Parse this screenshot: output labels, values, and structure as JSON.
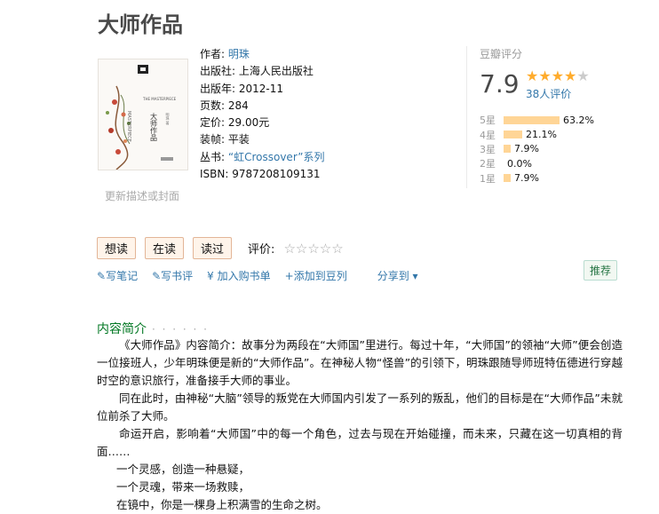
{
  "title": "大师作品",
  "cover": {
    "update_link": "更新描述或封面",
    "vertical_title": "大师作品",
    "latin": "MASTERPIECE"
  },
  "info": {
    "author_label": "作者:",
    "author": "明珠",
    "publisher_label": "出版社:",
    "publisher": "上海人民出版社",
    "year_label": "出版年:",
    "year": "2012-11",
    "pages_label": "页数:",
    "pages": "284",
    "price_label": "定价:",
    "price": "29.00元",
    "binding_label": "装帧:",
    "binding": "平装",
    "series_label": "丛书:",
    "series": "“虹Crossover”系列",
    "isbn_label": "ISBN:",
    "isbn": "9787208109131"
  },
  "rating": {
    "label": "豆瓣评分",
    "score": "7.9",
    "stars_on": "★★★★",
    "stars_off": "★",
    "count": "38人评价",
    "bars": [
      {
        "label": "5星",
        "pct": "63.2%",
        "fraction": 0.632
      },
      {
        "label": "4星",
        "pct": "21.1%",
        "fraction": 0.211
      },
      {
        "label": "3星",
        "pct": "7.9%",
        "fraction": 0.079
      },
      {
        "label": "2星",
        "pct": "0.0%",
        "fraction": 0.0
      },
      {
        "label": "1星",
        "pct": "7.9%",
        "fraction": 0.079
      }
    ]
  },
  "buttons": {
    "want": "想读",
    "reading": "在读",
    "read": "读过"
  },
  "eval": {
    "label": "评价:",
    "stars": "☆☆☆☆☆"
  },
  "actions": {
    "note": "写笔记",
    "review": "写书评",
    "cart": "加入购书单",
    "doulist": "添加到豆列",
    "share": "分享到 ▾"
  },
  "recommend": "推荐",
  "intro": {
    "heading": "内容简介",
    "dots": "· · · · · ·",
    "paragraphs": [
      "《大师作品》内容简介：故事分为两段在“大师国”里进行。每过十年，“大师国”的领袖“大师”便会创造一位接班人，少年明珠便是新的“大师作品”。在神秘人物“怪兽”的引领下，明珠跟随导师班特伍德进行穿越时空的意识旅行，准备接手大师的事业。",
      "同在此时，由神秘“大脑”领导的叛党在大师国内引发了一系列的叛乱，他们的目标是在“大师作品”未就位前杀了大师。",
      "命运开启，影响着“大师国”中的每一个角色，过去与现在开始碰撞，而未来，只藏在这一切真相的背面……"
    ],
    "poem": [
      "一个灵感，创造一种悬疑，",
      "一个灵魂，带来一场救赎，",
      "在镜中，你是一棵身上积满雪的生命之树。"
    ]
  }
}
